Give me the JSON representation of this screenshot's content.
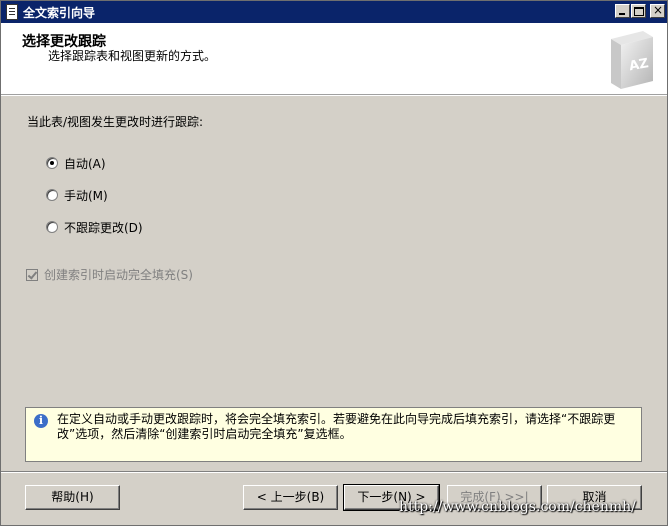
{
  "window": {
    "title": "全文索引向导",
    "controls": {
      "minimize": "_",
      "maximize": "□",
      "close": "×"
    }
  },
  "header": {
    "heading": "选择更改跟踪",
    "subheading": "选择跟踪表和视图更新的方式。",
    "logo_text": "AZ",
    "logo_icon": "book-az-icon"
  },
  "main": {
    "prompt": "当此表/视图发生更改时进行跟踪:",
    "options": [
      {
        "label": "自动(A)",
        "selected": true
      },
      {
        "label": "手动(M)",
        "selected": false
      },
      {
        "label": "不跟踪更改(D)",
        "selected": false
      }
    ],
    "full_population_checkbox": {
      "label": "创建索引时启动完全填充(S)",
      "checked": true,
      "enabled": false
    }
  },
  "info": {
    "icon": "info-icon",
    "text": "在定义自动或手动更改跟踪时，将会完全填充索引。若要避免在此向导完成后填充索引，请选择“不跟踪更改”选项，然后清除“创建索引时启动完全填充”复选框。"
  },
  "buttons": {
    "help": "帮助(H)",
    "back": "< 上一步(B)",
    "next": "下一步(N) >",
    "finish": "完成(F) >>|",
    "cancel": "取消"
  },
  "watermark": "http://www.cnblogs.com/chenmh/",
  "colors": {
    "titlebar": "#0a246a",
    "dialog_bg": "#d4d0c8",
    "info_bg": "#ffffe1",
    "disabled_text": "#808080"
  }
}
